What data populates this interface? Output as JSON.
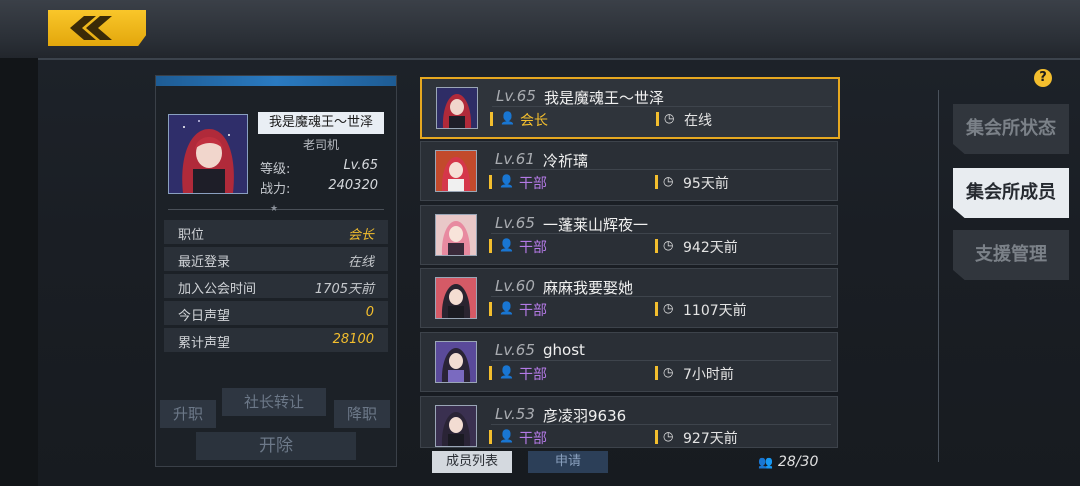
{
  "profile": {
    "name": "我是魔魂王～世泽",
    "title": "老司机",
    "level_label": "等级:",
    "level_value": "Lv.65",
    "power_label": "战力:",
    "power_value": "240320",
    "rows": [
      {
        "label": "职位",
        "value": "会长"
      },
      {
        "label": "最近登录",
        "value": "在线"
      },
      {
        "label": "加入公会时间",
        "value": "1705天前"
      },
      {
        "label": "今日声望",
        "value": "0"
      },
      {
        "label": "累计声望",
        "value": "28100"
      }
    ],
    "actions": {
      "promote": "升职",
      "transfer": "社长转让",
      "demote": "降职",
      "fire": "开除"
    }
  },
  "members": [
    {
      "level": "Lv.65",
      "name": "我是魔魂王～世泽",
      "role": "会长",
      "status": "在线",
      "selected": true
    },
    {
      "level": "Lv.61",
      "name": "冷祈璃",
      "role": "干部",
      "status": "95天前"
    },
    {
      "level": "Lv.65",
      "name": "一蓬莱山辉夜一",
      "role": "干部",
      "status": "942天前"
    },
    {
      "level": "Lv.60",
      "name": "麻麻我要娶她",
      "role": "干部",
      "status": "1107天前"
    },
    {
      "level": "Lv.65",
      "name": "ghost",
      "role": "干部",
      "status": "7小时前"
    },
    {
      "level": "Lv.53",
      "name": "彦凌羽9636",
      "role": "干部",
      "status": "927天前"
    }
  ],
  "bottom": {
    "tab_members": "成员列表",
    "tab_apply": "申请",
    "count": "28/30"
  },
  "side_menu": {
    "status": "集会所状态",
    "members": "集会所成员",
    "support": "支援管理"
  },
  "help": "?",
  "colors": {
    "accent": "#f3be2e",
    "officer": "#b47ae6",
    "selected_border": "#e6a820"
  }
}
